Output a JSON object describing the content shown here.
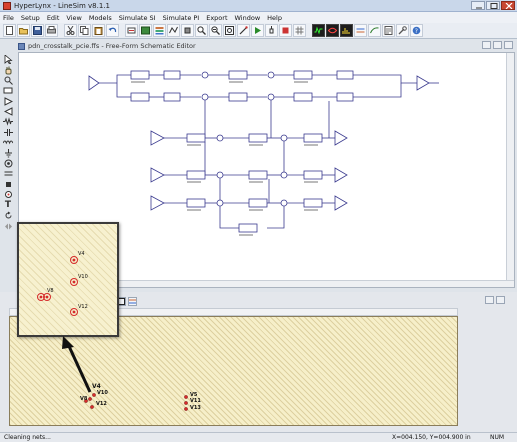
{
  "window": {
    "title": "HyperLynx - LineSim v8.1.1"
  },
  "menu": {
    "items": [
      "File",
      "Setup",
      "Edit",
      "View",
      "Models",
      "Simulate SI",
      "Simulate PI",
      "Export",
      "Window",
      "Help"
    ]
  },
  "editor": {
    "document_title": "pdn_crosstalk_pcie.ffs - Free-Form Schematic Editor",
    "tool_icons": [
      "pointer-icon",
      "hand-icon",
      "zoom-icon",
      "transmission-line-icon",
      "driver-icon",
      "receiver-icon",
      "resistor-icon",
      "capacitor-icon",
      "inductor-icon",
      "ground-icon",
      "via-icon",
      "text-icon",
      "rotate-icon",
      "flip-icon"
    ],
    "text_tool_glyph": "T"
  },
  "pcb_view": {
    "board_labels": [
      "V4",
      "V10",
      "V8",
      "V12",
      "V5",
      "V11",
      "V13"
    ],
    "callout_labels": [
      "V4",
      "V10",
      "V8",
      "V12"
    ]
  },
  "status": {
    "left": "Cleaning nets...",
    "coords": "X=004.150, Y=004.900 in",
    "num": "NUM"
  },
  "colors": {
    "board_fill": "#f6efc9",
    "net_line": "#3b3b8f",
    "via_red": "#d62a2a",
    "arrow": "#111111"
  }
}
